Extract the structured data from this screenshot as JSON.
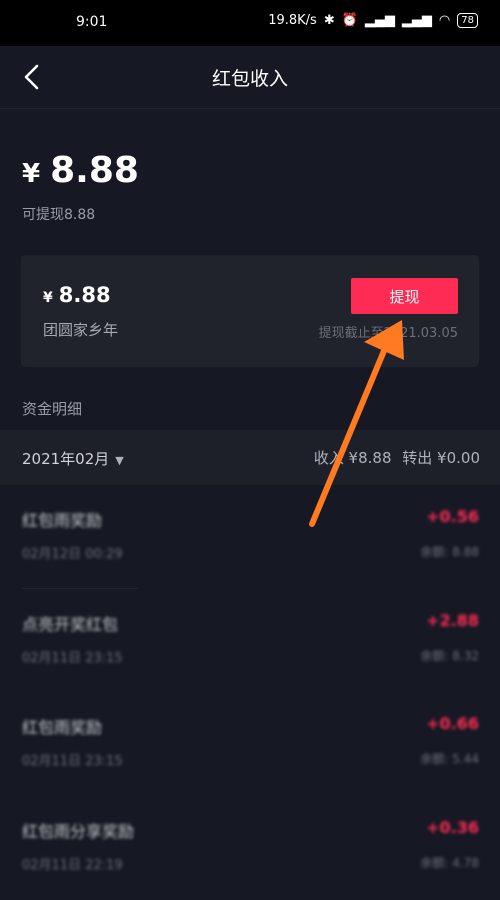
{
  "status_bar": {
    "time": "9:01",
    "net_speed": "19.8K/s",
    "battery": "78"
  },
  "header": {
    "title": "红包收入"
  },
  "balance": {
    "currency": "¥",
    "amount": "8.88",
    "withdrawable": "可提现8.88"
  },
  "card": {
    "currency": "¥",
    "amount": "8.88",
    "name": "团圆家乡年",
    "button_label": "提现",
    "deadline": "提现截止至2021.03.05"
  },
  "section_label": "资金明细",
  "month_bar": {
    "month": "2021年02月",
    "income": "收入 ¥8.88",
    "out": "转出 ¥0.00"
  },
  "transactions": [
    {
      "name": "红包雨奖励",
      "date": "02月12日 00:29",
      "amount": "+0.56",
      "remain": "余额: 8.88"
    },
    {
      "name": "点亮开奖红包",
      "date": "02月11日 23:15",
      "amount": "+2.88",
      "remain": "余额: 8.32"
    },
    {
      "name": "红包雨奖励",
      "date": "02月11日 23:15",
      "amount": "+0.66",
      "remain": "余额: 5.44"
    },
    {
      "name": "红包雨分享奖励",
      "date": "02月11日 22:19",
      "amount": "+0.36",
      "remain": "余额: 4.78"
    }
  ],
  "colors": {
    "accent": "#fe2c55",
    "background": "#161823",
    "arrow": "#ff7a21"
  }
}
